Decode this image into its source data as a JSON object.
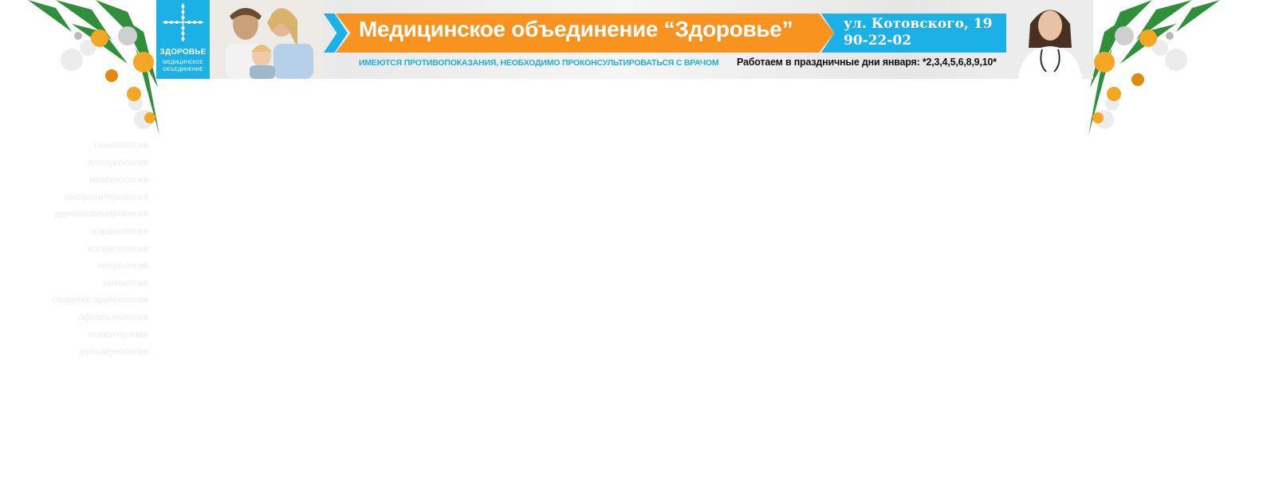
{
  "header": {
    "logo_name": "ЗДОРОВЬЕ",
    "logo_sub_line1": "МЕДИЦИНСКОЕ",
    "logo_sub_line2": "ОБЪЕДИНЕНИЕ",
    "title": "Медицинское объединение “Здоровье”",
    "address": "ул. Котовского, 19",
    "phone": "90-22-02",
    "disclaimer": "ИМЕЮТСЯ ПРОТИВОПОКАЗАНИЯ, НЕОБХОДИМО ПРОКОНСУЛЬТИРОВАТЬСЯ С ВРАЧОМ",
    "holiday_note": "Работаем в праздничные дни января: *2,3,4,5,6,8,9,10*",
    "colors": {
      "orange": "#f7931e",
      "blue": "#1bb0e6"
    }
  },
  "side_menu": {
    "items": [
      {
        "label": "гинекология"
      },
      {
        "label": "аллергология"
      },
      {
        "label": "иммунология"
      },
      {
        "label": "гастроэнтерология"
      },
      {
        "label": "дерматовенерология"
      },
      {
        "label": "кардиология"
      },
      {
        "label": "косметология"
      },
      {
        "label": "неврология"
      },
      {
        "label": "онкология"
      },
      {
        "label": "оториноларингология"
      },
      {
        "label": "офтальмология"
      },
      {
        "label": "психотерапия"
      },
      {
        "label": "пульмонология"
      }
    ]
  }
}
